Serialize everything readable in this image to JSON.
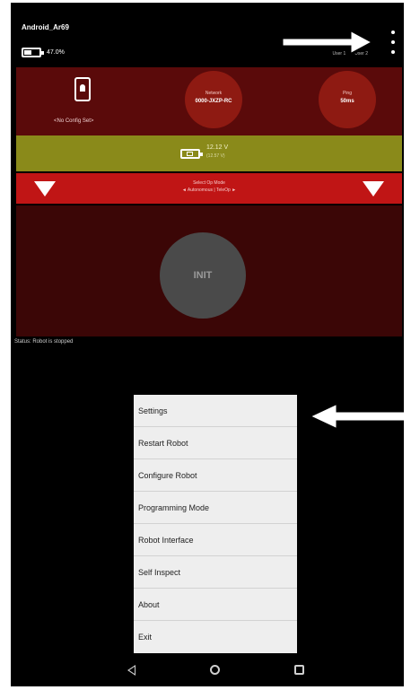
{
  "status_bar": {
    "device_name": "Android_Ar69",
    "battery_percent": "47.0%",
    "battery_level": 0.47,
    "gamepad_labels": [
      "User 1",
      "User 2"
    ]
  },
  "info_panel": {
    "config_label": "<No Config Set>",
    "network_label": "Network",
    "network_value": "0000-JXZP-RC",
    "ping_label": "Ping",
    "ping_value": "50ms"
  },
  "power": {
    "voltage": "12.12 V",
    "voltage_sub": "(12.57 V)"
  },
  "opmode": {
    "title": "Select Op Mode",
    "subtitle": "◄ Autonomous | TeleOp ►"
  },
  "init_button": {
    "label": "INIT"
  },
  "status_text": "Status: Robot is stopped",
  "menu": {
    "items": [
      "Settings",
      "Restart Robot",
      "Configure Robot",
      "Programming Mode",
      "Robot Interface",
      "Self Inspect",
      "About",
      "Exit"
    ]
  },
  "colors": {
    "panel_red_dark": "#5a0a0a",
    "circle_red": "#8e1a12",
    "power_olive": "#8a8a1a",
    "opmode_red": "#c01515",
    "init_panel": "#3b0606",
    "menu_bg": "#eeeeee"
  },
  "icons": [
    "battery-icon",
    "overflow-menu-icon",
    "phone-icon",
    "arrow-down-icon",
    "back-icon",
    "home-icon",
    "recents-icon"
  ]
}
